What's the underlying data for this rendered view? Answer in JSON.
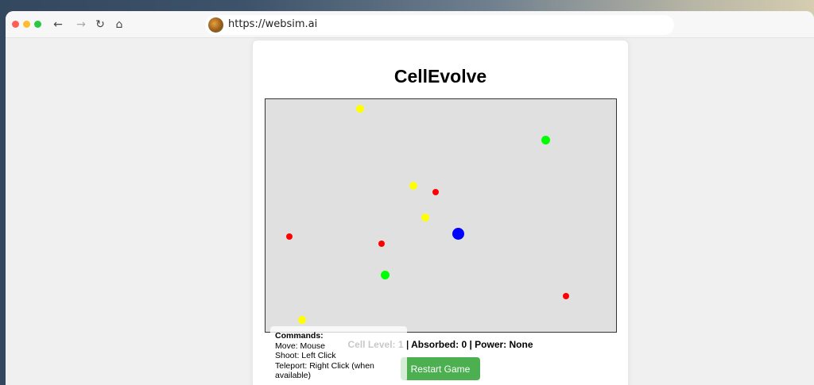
{
  "browser": {
    "url": "https://websim.ai",
    "back_icon": "←",
    "forward_icon": "→",
    "reload_icon": "↻",
    "home_icon": "⌂"
  },
  "game": {
    "title": "CellEvolve",
    "status": "Cell Level: 1 | Absorbed: 0 | Power: None",
    "restart_label": "Restart Game",
    "commands": {
      "heading": "Commands:",
      "move": "Move: Mouse",
      "shoot": "Shoot: Left Click",
      "teleport": "Teleport: Right Click (when available)"
    }
  },
  "colors": {
    "player": "#0000ff",
    "yellow": "#ffff00",
    "green": "#00ff00",
    "red": "#ff0000",
    "button": "#4caf50"
  }
}
